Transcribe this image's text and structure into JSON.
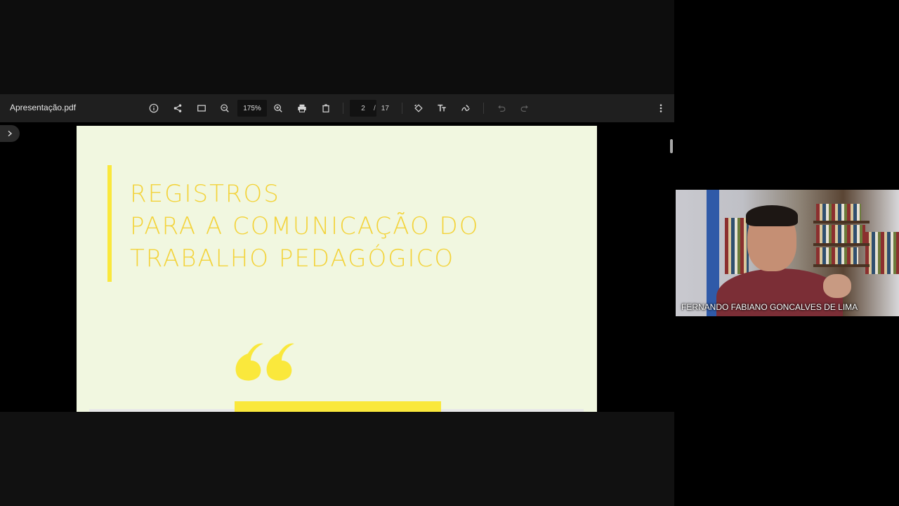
{
  "pdf_viewer": {
    "file_name": "Apresentação.pdf",
    "zoom_level": "175%",
    "page_current": "2",
    "page_separator": "/",
    "page_total": "17"
  },
  "slide": {
    "title_lines": [
      "REGISTROS",
      "PARA A COMUNICAÇÃO DO",
      "TRABALHO PEDAGÓGICO"
    ]
  },
  "participant": {
    "name": "FERNANDO FABIANO GONCALVES DE LIMA"
  },
  "colors": {
    "slide_background": "#f1f7e0",
    "accent_yellow": "#fae83c",
    "title_yellow": "#f3d33a",
    "toolbar_background": "#1f1f1f"
  },
  "icons": {
    "toolbar": [
      "info-icon",
      "share-icon",
      "fit-page-icon",
      "zoom-out-icon",
      "zoom-in-icon",
      "print-icon",
      "delete-icon",
      "rotate-icon",
      "text-icon",
      "annotate-icon",
      "undo-icon",
      "redo-icon",
      "more-vert-icon"
    ],
    "sidebar": "chevron-right-icon"
  }
}
